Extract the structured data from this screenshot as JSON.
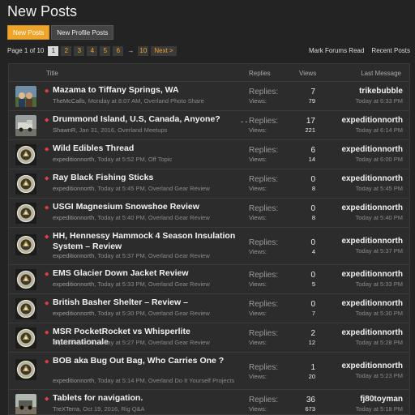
{
  "page": {
    "title": "New Posts"
  },
  "tabs": [
    {
      "label": "New Posts",
      "active": true
    },
    {
      "label": "New Profile Posts",
      "active": false
    }
  ],
  "pagination": {
    "label": "Page 1 of 10",
    "pages": [
      "1",
      "2",
      "3",
      "4",
      "5",
      "6"
    ],
    "ellipsis_arrow": "→",
    "last_page": "10",
    "next": "Next >"
  },
  "links": {
    "mark_read": "Mark Forums Read",
    "recent_posts": "Recent Posts"
  },
  "columns": {
    "title": "Title",
    "replies": "Replies",
    "views": "Views",
    "last": "Last Message"
  },
  "labels": {
    "replies": "Replies:",
    "views": "Views:"
  },
  "threads": [
    {
      "title": "Mazama to Tiffany Springs, WA",
      "author": "TheMcCalls",
      "date": "Monday at 8:07 AM",
      "forum": "Overland Photo Share",
      "replies": "7",
      "views": "79",
      "last_user": "trikebubble",
      "last_time": "Today at 6:33 PM",
      "avatar": "photo"
    },
    {
      "title": "Drummond Island, U.S, Canada, Anyone?",
      "author": "ShawnR",
      "date": "Jan 31, 2016",
      "forum": "Overland Meetups",
      "replies": "17",
      "views": "221",
      "last_user": "expeditionnorth",
      "last_time": "Today at 6:14 PM",
      "avatar": "truck",
      "dash": "- -"
    },
    {
      "title": "Wild Edibles Thread",
      "author": "expeditionnorth",
      "date": "Today at 5:52 PM",
      "forum": "Off Topic",
      "replies": "6",
      "views": "14",
      "last_user": "expeditionnorth",
      "last_time": "Today at 6:00 PM",
      "avatar": "seal"
    },
    {
      "title": "Ray Black Fishing Sticks",
      "author": "expeditionnorth",
      "date": "Today at 5:45 PM",
      "forum": "Overland Gear Review",
      "replies": "0",
      "views": "8",
      "last_user": "expeditionnorth",
      "last_time": "Today at 5:45 PM",
      "avatar": "seal"
    },
    {
      "title": "USGI Magnesium Snowshoe Review",
      "author": "expeditionnorth",
      "date": "Today at 5:40 PM",
      "forum": "Overland Gear Review",
      "replies": "0",
      "views": "8",
      "last_user": "expeditionnorth",
      "last_time": "Today at 5:40 PM",
      "avatar": "seal"
    },
    {
      "title": "HH, Hennessy Hammock 4 Season Insulation System – Review",
      "author": "expeditionnorth",
      "date": "Today at 5:37 PM",
      "forum": "Overland Gear Review",
      "replies": "0",
      "views": "4",
      "last_user": "expeditionnorth",
      "last_time": "Today at 5:37 PM",
      "avatar": "seal",
      "tall": true
    },
    {
      "title": "EMS Glacier Down Jacket Review",
      "author": "expeditionnorth",
      "date": "Today at 5:33 PM",
      "forum": "Overland Gear Review",
      "replies": "0",
      "views": "5",
      "last_user": "expeditionnorth",
      "last_time": "Today at 5:33 PM",
      "avatar": "seal"
    },
    {
      "title": "British Basher Shelter – Review –",
      "author": "expeditionnorth",
      "date": "Today at 5:30 PM",
      "forum": "Overland Gear Review",
      "replies": "0",
      "views": "7",
      "last_user": "expeditionnorth",
      "last_time": "Today at 5:30 PM",
      "avatar": "seal"
    },
    {
      "title": "MSR PocketRocket vs Whisperlite Internationale",
      "author": "expeditionnorth",
      "date": "Today at 5:27 PM",
      "forum": "Overland Gear Review",
      "replies": "2",
      "views": "12",
      "last_user": "expeditionnorth",
      "last_time": "Today at 5:28 PM",
      "avatar": "seal"
    },
    {
      "title": "BOB aka Bug Out Bag, Who Carries One ?",
      "author": "expeditionnorth",
      "date": "Today at 5:14 PM",
      "forum": "Overland Do It Yourself Projects",
      "replies": "1",
      "views": "20",
      "last_user": "expeditionnorth",
      "last_time": "Today at 5:23 PM",
      "avatar": "seal",
      "tall_meta": true
    },
    {
      "title": "Tablets for navigation.",
      "author": "TreXTerra",
      "date": "Oct 19, 2016",
      "forum": "Rig Q&A",
      "replies": "36",
      "views": "673",
      "last_user": "fj80toyman",
      "last_time": "Today at 5:18 PM",
      "avatar": "truck2"
    }
  ]
}
